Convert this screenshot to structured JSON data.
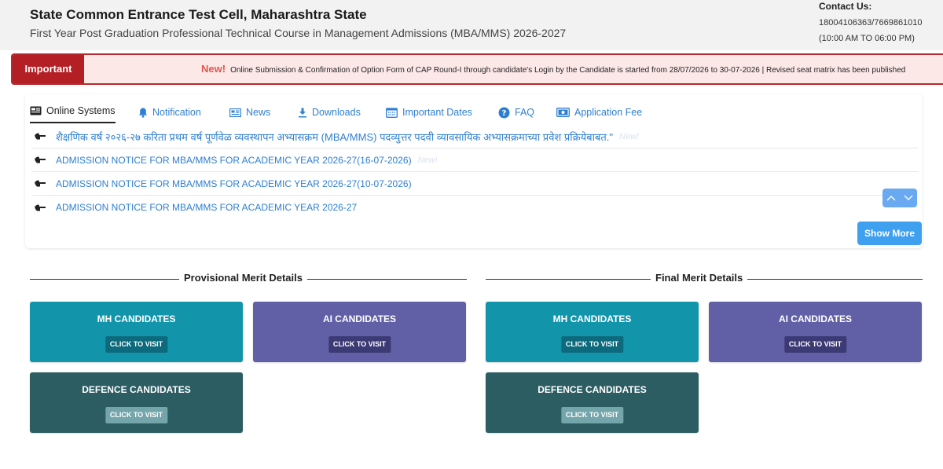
{
  "header": {
    "title": "State Common Entrance Test Cell, Maharashtra State",
    "subtitle": "First Year Post Graduation Professional Technical Course in Management Admissions (MBA/MMS) 2026-2027",
    "contact_label": "Contact Us:",
    "contact_phone": "18004106363/7669861010",
    "contact_hours": "(10:00 AM TO 06:00 PM)"
  },
  "ticker": {
    "label": "Important",
    "new_label": "New!",
    "text": "Online Submission & Confirmation of Option Form of CAP Round-I through candidate's Login by the Candidate is started from 28/07/2026 to 30-07-2026 | Revised seat matrix has been published"
  },
  "tabs": [
    {
      "label": "Online Systems",
      "icon": "monitor-icon",
      "active": true
    },
    {
      "label": "Notification",
      "icon": "bell-icon"
    },
    {
      "label": "News",
      "icon": "newspaper-icon"
    },
    {
      "label": "Downloads",
      "icon": "download-icon"
    },
    {
      "label": "Important Dates",
      "icon": "calendar-icon"
    },
    {
      "label": "FAQ",
      "icon": "question-icon"
    },
    {
      "label": "Application Fee",
      "icon": "money-icon"
    }
  ],
  "notices": [
    {
      "text": "शैक्षणिक वर्ष २०२६-२७ करिता प्रथम वर्ष पूर्णवेळ व्यवस्थापन अभ्यासक्रम (MBA/MMS) पदव्युत्तर पदवी व्यावसायिक अभ्यासक्रमाच्या प्रवेश प्रक्रियेबाबत.\"",
      "new": "New!"
    },
    {
      "text": "ADMISSION NOTICE FOR MBA/MMS FOR ACADEMIC YEAR 2026-27(16-07-2026)",
      "new": "New!"
    },
    {
      "text": "ADMISSION NOTICE FOR MBA/MMS FOR ACADEMIC YEAR 2026-27(10-07-2026)",
      "new": ""
    },
    {
      "text": "ADMISSION NOTICE FOR MBA/MMS FOR ACADEMIC YEAR 2026-27",
      "new": ""
    }
  ],
  "show_more_label": "Show More",
  "provisional": {
    "title": "Provisional Merit Details",
    "cards": [
      {
        "title": "MH CANDIDATES",
        "button": "CLICK TO VISIT"
      },
      {
        "title": "AI CANDIDATES",
        "button": "CLICK TO VISIT"
      },
      {
        "title": "DEFENCE CANDIDATES",
        "button": "CLICK TO VISIT"
      }
    ]
  },
  "final": {
    "title": "Final Merit Details",
    "cards": [
      {
        "title": "MH CANDIDATES",
        "button": "CLICK TO VISIT"
      },
      {
        "title": "AI CANDIDATES",
        "button": "CLICK TO VISIT"
      },
      {
        "title": "DEFENCE CANDIDATES",
        "button": "CLICK TO VISIT"
      }
    ]
  },
  "colors": {
    "accent_blue": "#2f7fd1",
    "important_red": "#b31f24",
    "card_teal": "#1294ab",
    "card_purple": "#6160a6",
    "card_dark": "#2c5d63"
  }
}
